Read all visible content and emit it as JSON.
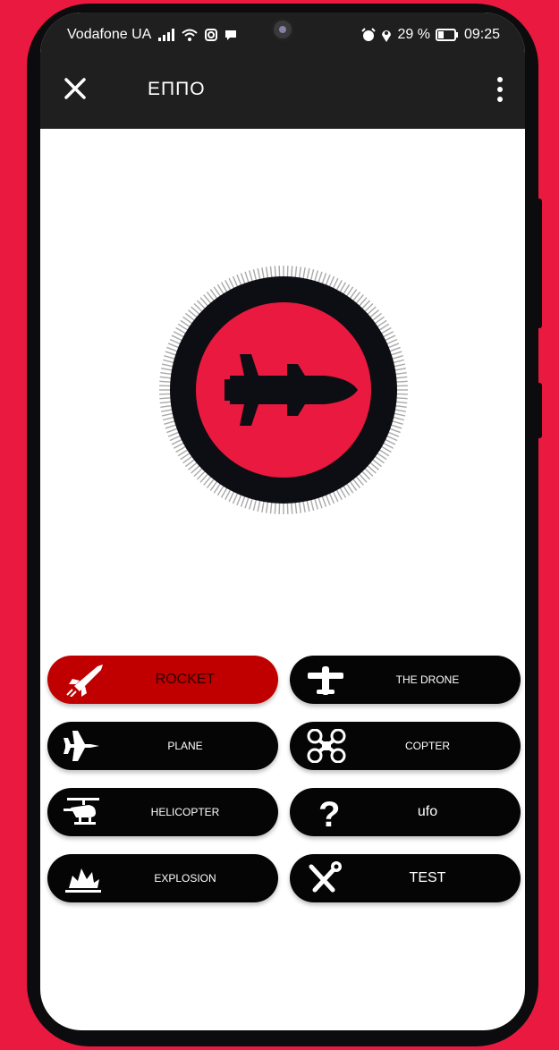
{
  "status_bar": {
    "carrier": "Vodafone UA",
    "battery": "29 %",
    "time": "09:25"
  },
  "app_bar": {
    "title": "ЕППО"
  },
  "emblem": {
    "icon": "missile-icon",
    "ring_color": "#0d0d14",
    "center_color": "#e9193f"
  },
  "threat_buttons": [
    {
      "label": "ROCKET",
      "icon": "rocket-icon",
      "selected": true
    },
    {
      "label": "THE DRONE",
      "icon": "drone-icon",
      "selected": false
    },
    {
      "label": "PLANE",
      "icon": "plane-icon",
      "selected": false
    },
    {
      "label": "COPTER",
      "icon": "quadcopter-icon",
      "selected": false
    },
    {
      "label": "HELICOPTER",
      "icon": "helicopter-icon",
      "selected": false
    },
    {
      "label": "ufo",
      "icon": "question-mark-icon",
      "selected": false
    },
    {
      "label": "EXPLOSION",
      "icon": "explosion-icon",
      "selected": false
    },
    {
      "label": "TEST",
      "icon": "tools-icon",
      "selected": false
    }
  ],
  "colors": {
    "background": "#e9193f",
    "selected_button": "#c00000",
    "button": "#050505"
  }
}
